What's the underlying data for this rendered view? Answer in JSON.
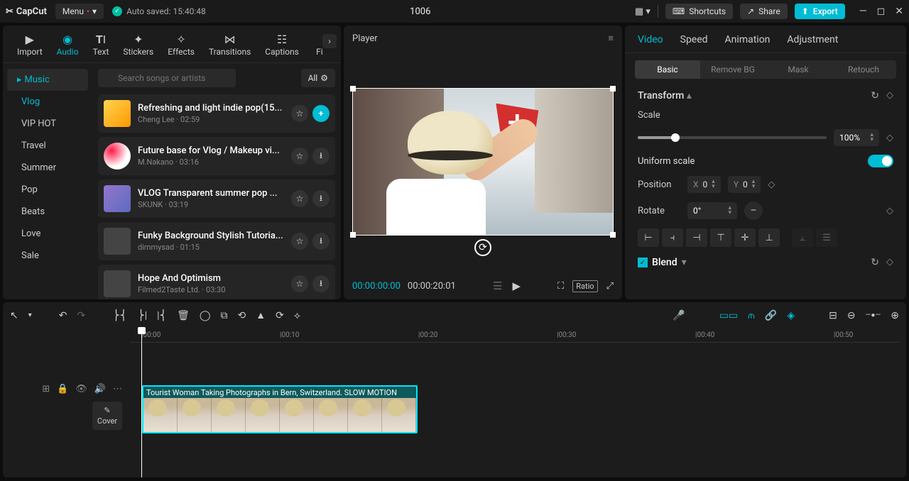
{
  "titlebar": {
    "app": "CapCut",
    "menu": "Menu",
    "autosave": "Auto saved: 15:40:48",
    "project": "1006",
    "shortcuts": "Shortcuts",
    "share": "Share",
    "export": "Export"
  },
  "media_tabs": [
    "Import",
    "Audio",
    "Text",
    "Stickers",
    "Effects",
    "Transitions",
    "Captions",
    "Fi"
  ],
  "media_active": 1,
  "music_nav": {
    "header": "Music",
    "items": [
      "Vlog",
      "VIP HOT",
      "Travel",
      "Summer",
      "Pop",
      "Beats",
      "Love",
      "Sale"
    ],
    "active": 0
  },
  "search": {
    "placeholder": "Search songs or artists",
    "all": "All"
  },
  "tracks": [
    {
      "title": "Refreshing and light indie pop(15...",
      "artist": "Cheng Lee",
      "dur": "02:59",
      "add": true
    },
    {
      "title": "Future base for Vlog / Makeup vi...",
      "artist": "M.Nakano",
      "dur": "03:16"
    },
    {
      "title": "VLOG Transparent summer pop ...",
      "artist": "SKUNK",
      "dur": "03:19"
    },
    {
      "title": "Funky Background Stylish Tutoria...",
      "artist": "dimmysad",
      "dur": "01:15"
    },
    {
      "title": "Hope And Optimism",
      "artist": "Filmed2Taste Ltd.",
      "dur": "03:30"
    }
  ],
  "player": {
    "title": "Player",
    "current": "00:00:00:00",
    "total": "00:00:20:01",
    "ratio": "Ratio"
  },
  "props": {
    "tabs": [
      "Video",
      "Speed",
      "Animation",
      "Adjustment"
    ],
    "subtabs": [
      "Basic",
      "Remove BG",
      "Mask",
      "Retouch"
    ],
    "transform": "Transform",
    "scale": "Scale",
    "scale_val": "100%",
    "uniform": "Uniform scale",
    "position": "Position",
    "posX": "0",
    "posY": "0",
    "rotate": "Rotate",
    "rotate_val": "0°",
    "blend": "Blend"
  },
  "timeline": {
    "ticks": [
      "00:00",
      "00:10",
      "00:20",
      "00:30",
      "00:40",
      "00:50"
    ],
    "cover": "Cover",
    "clip_label": "Tourist Woman Taking Photographs in Bern, Switzerland. SLOW MOTION"
  }
}
